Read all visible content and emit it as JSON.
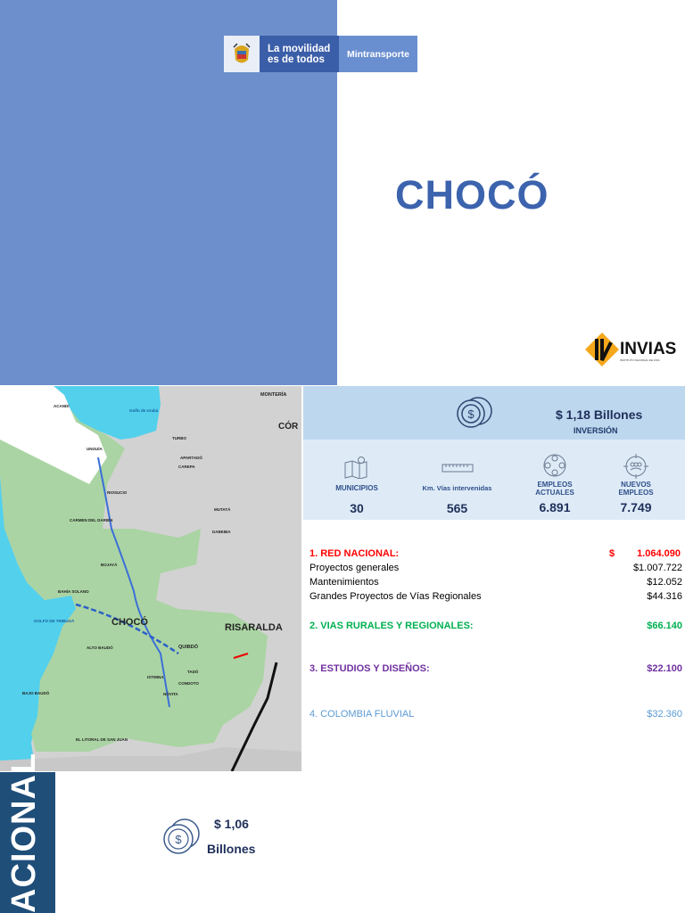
{
  "header": {
    "logo_slogan_1": "La movilidad",
    "logo_slogan_2": "es de todos",
    "logo_ministry": "Mintransporte",
    "title": "CHOCÓ",
    "invias_logo": "INVIAS",
    "invias_subtitle": "INSTITUTO NACIONAL DE VÍAS"
  },
  "map": {
    "labels": {
      "choco": "CHOCÓ",
      "risaralda": "RISARALDA",
      "quibdo": "QUIBDÓ",
      "monteria": "MONTERÍA",
      "cordoba": "CÓR",
      "acandi": "ACANDÍ",
      "unguia": "UNGUÍA",
      "riosucio": "RIOSUCIO",
      "carmen_darien": "CARMEN DEL DARIÉN",
      "bojaya": "BOJAYÁ",
      "bahia_solano": "BAHÍA SOLANO",
      "alto_baudo": "ALTO BAUDÓ",
      "bajo_baudo": "BAJO BAUDÓ",
      "istmina": "ISTMINA",
      "tado": "TADÓ",
      "condoto": "CONDOTO",
      "novita": "NÓVITA",
      "litoral": "EL LITORAL DE SAN JUAN",
      "apartado": "APARTADÓ",
      "turbo": "TURBO",
      "carepa": "CAREPA",
      "mutata": "MUTATÁ",
      "dabeiba": "DABEIBA",
      "golfo_tribuga": "GOLFO DE TRIBUGÁ",
      "golfo_uraba": "Golfo de Urabá"
    }
  },
  "investment": {
    "amount": "$ 1,18 Billones",
    "label": "INVERSIÓN"
  },
  "stats": [
    {
      "icon": "map-icon",
      "label": "MUNICIPIOS",
      "value": "30"
    },
    {
      "icon": "ruler-icon",
      "label": "Km. Vías intervenidas",
      "value": "565"
    },
    {
      "icon": "people-network-icon",
      "label": "EMPLEOS ACTUALES",
      "value": "6.891"
    },
    {
      "icon": "target-people-icon",
      "label": "NUEVOS EMPLEOS",
      "value": "7.749"
    }
  ],
  "breakdown": {
    "red_nacional": {
      "label": "1.  RED NACIONAL:",
      "currency": "$",
      "value": "1.064.090",
      "color": "#ff0000"
    },
    "items": [
      {
        "label": "Proyectos generales",
        "value": "$1.007.722"
      },
      {
        "label": "Mantenimientos",
        "value": "$12.052"
      },
      {
        "label": "Grandes Proyectos de Vías Regionales",
        "value": "$44.316"
      }
    ],
    "vias_rurales": {
      "label": "2. VIAS RURALES Y REGIONALES:",
      "value": "$66.140",
      "color": "#00b050"
    },
    "estudios": {
      "label": "3. ESTUDIOS Y DISEÑOS:",
      "value": "$22.100",
      "color": "#7030a0"
    },
    "fluvial": {
      "label": "4. COLOMBIA FLUVIAL",
      "value": "$32.360",
      "color": "#5b9bd5"
    }
  },
  "nacional": {
    "side_label": "ACIONAL",
    "amount": "$ 1,06",
    "unit": "Billones"
  }
}
